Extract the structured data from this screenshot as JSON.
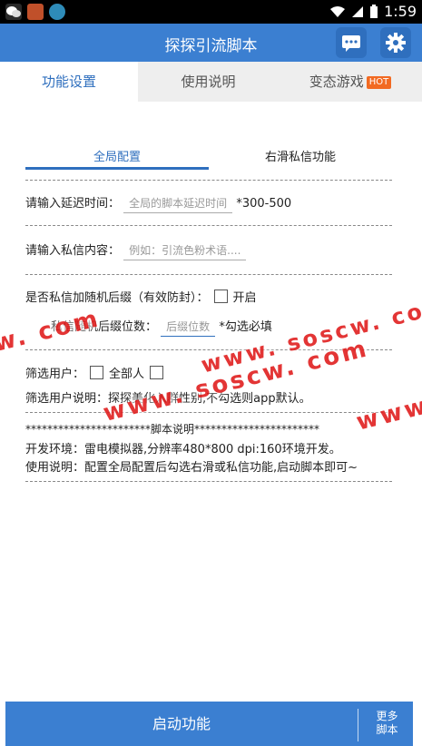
{
  "status_bar": {
    "time": "1:59"
  },
  "app_bar": {
    "title": "探探引流脚本"
  },
  "tabs": [
    {
      "label": "功能设置"
    },
    {
      "label": "使用说明"
    },
    {
      "label": "变态游戏",
      "badge": "HOT"
    }
  ],
  "sub_tabs": [
    {
      "label": "全局配置"
    },
    {
      "label": "右滑私信功能"
    }
  ],
  "form": {
    "delay_label": "请输入延迟时间：",
    "delay_placeholder": "全局的脚本延迟时间",
    "delay_hint": "*300-500",
    "message_label": "请输入私信内容：",
    "message_placeholder": "例如：引流色粉术语....",
    "suffix_label": "是否私信加随机后缀（有效防封）：",
    "suffix_option": "开启",
    "suffix_digits_label": "私信随机后缀位数：",
    "suffix_digits_placeholder": "后缀位数",
    "suffix_digits_hint": "*勾选必填",
    "filter_label": "筛选用户：",
    "filter_all": "全部人",
    "filter_desc": "筛选用户说明：探探美化入群性别,不勾选则app默认。"
  },
  "script_info": {
    "heading": "***********************脚本说明***********************",
    "env": "开发环境：雷电模拟器,分辨率480*800 dpi:160环境开发。",
    "usage": "使用说明：配置全局配置后勾选右滑或私信功能,启动脚本即可~"
  },
  "watermarks": [
    "w. com",
    "www. soscw. com",
    "www. soscw. com",
    "www."
  ],
  "bottom_bar": {
    "start_label": "启动功能",
    "more_label_1": "更多",
    "more_label_2": "脚本"
  },
  "colors": {
    "primary": "#3b7fd1",
    "watermark": "#e02020",
    "hot": "#f26a22"
  }
}
